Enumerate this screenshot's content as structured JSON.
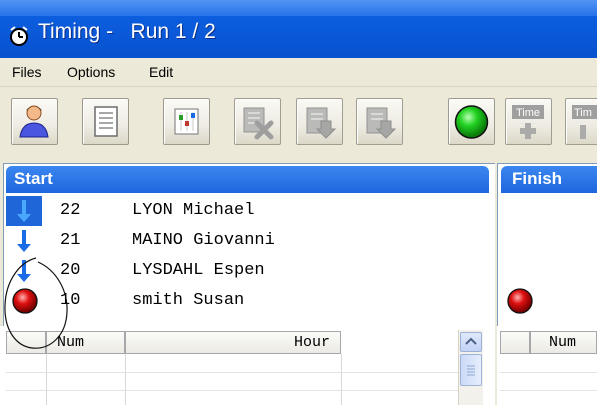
{
  "window": {
    "title": "Timing -   Run 1 / 2"
  },
  "menu": {
    "items": [
      "Files",
      "Options",
      "Edit"
    ]
  },
  "toolbar": {
    "buttons": [
      {
        "icon": "person-icon"
      },
      {
        "icon": "list-document-icon"
      },
      {
        "icon": "columns-settings-icon"
      },
      {
        "icon": "delete-record-icon"
      },
      {
        "icon": "move-down-icon"
      },
      {
        "icon": "move-down-disabled-icon"
      },
      {
        "icon": "green-light-icon"
      },
      {
        "icon": "time-plus-icon",
        "label": "Time"
      },
      {
        "icon": "time-icon",
        "label": "Tim"
      }
    ]
  },
  "start_panel": {
    "title": "Start",
    "rows": [
      {
        "num": "22",
        "name": "LYON Michael",
        "icon": "blue-arrow-down-icon",
        "selected": true
      },
      {
        "num": "21",
        "name": "MAINO Giovanni",
        "icon": "blue-arrow-down-icon"
      },
      {
        "num": "20",
        "name": "LYSDAHL Espen",
        "icon": "blue-arrow-down-icon"
      },
      {
        "num": "10",
        "name": "smith Susan",
        "icon": "red-light-icon"
      }
    ]
  },
  "finish_panel": {
    "title": "Finish",
    "rows": [
      {
        "icon": "red-light-icon"
      }
    ]
  },
  "lower_grid": {
    "columns": [
      "Num",
      "Hour"
    ]
  },
  "finish_grid": {
    "columns": [
      "Num"
    ]
  },
  "colors": {
    "header_blue": "#1e66de",
    "arrow_blue": "#1a6ce6",
    "light_red": "#e01010",
    "light_green": "#13c713"
  }
}
